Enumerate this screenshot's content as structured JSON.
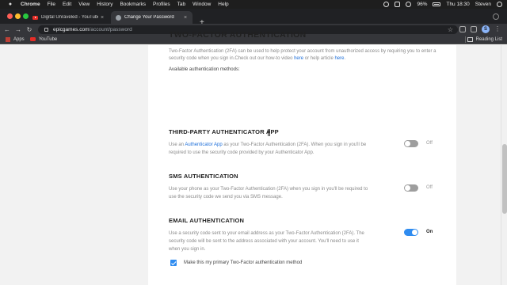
{
  "menubar": {
    "app": "Chrome",
    "items": [
      "File",
      "Edit",
      "View",
      "History",
      "Bookmarks",
      "Profiles",
      "Tab",
      "Window",
      "Help"
    ],
    "battery": "96%",
    "clock": "Thu 18:30",
    "user": "Steven"
  },
  "tabs": [
    {
      "title": "Digital Unraveled - YouTube",
      "close": "×"
    },
    {
      "title": "Change Your Password",
      "close": "×"
    }
  ],
  "new_tab": "+",
  "toolbar": {
    "back": "←",
    "forward": "→",
    "reload": "↻",
    "url_host": "epicgames.com",
    "url_path": "/account/password",
    "bookmark_star": "☆",
    "profile_initial": "S",
    "menu": "⋮"
  },
  "bookmarks": {
    "apps": "Apps",
    "youtube": "YouTube",
    "reading_list": "Reading List"
  },
  "page": {
    "title": "TWO-FACTOR AUTHENTICATION",
    "intro_before_links": "Two-Factor Authentication (2FA) can be used to help protect your account from unauthorized access by requiring you to enter a security code when you sign in.Check out our how-to video ",
    "link_here_1": "here",
    "intro_middle": " or help article ",
    "link_here_2": "here",
    "intro_end": ".",
    "available_methods": "Available authentication methods:",
    "sections": [
      {
        "title": "THIRD-PARTY AUTHENTICATOR APP",
        "desc_before": "Use an ",
        "desc_link": "Authenticator App",
        "desc_after": " as your Two-Factor Authentication (2FA). When you sign in you'll be required to use the security code provided by your Authenticator App.",
        "enabled": false,
        "state_label": "Off"
      },
      {
        "title": "SMS AUTHENTICATION",
        "desc": "Use your phone as your Two-Factor Authentication (2FA) when you sign in you'll be required to use the security code we send you via SMS message.",
        "enabled": false,
        "state_label": "Off"
      },
      {
        "title": "EMAIL AUTHENTICATION",
        "desc": "Use a security code sent to your email address as your Two-Factor Authentication (2FA). The security code will be sent to the address associated with your account. You'll need to use it when you sign in.",
        "enabled": true,
        "state_label": "On"
      }
    ],
    "primary_checkbox": {
      "checked": true,
      "label": "Make this my primary Two-Factor authentication method"
    }
  },
  "colors": {
    "accent": "#2f8cf0",
    "link": "#1e6fd9",
    "toggle_off": "#9e9e9e"
  }
}
